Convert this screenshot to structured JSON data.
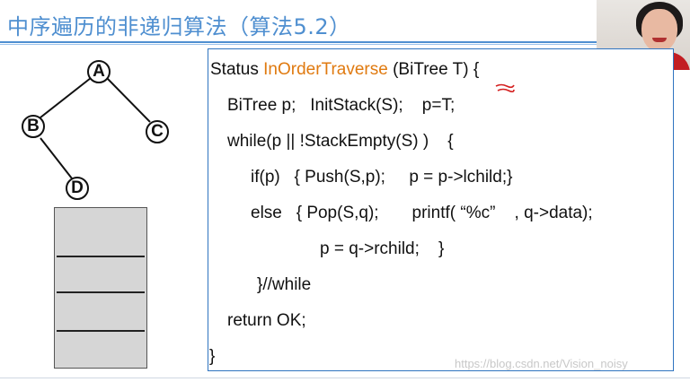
{
  "slide": {
    "title": "中序遍历的非递归算法（算法5.2）"
  },
  "tree": {
    "nodes": [
      "A",
      "B",
      "C",
      "D"
    ]
  },
  "code": {
    "line1_prefix": "Status ",
    "line1_fn": "InOrderTraverse",
    "line1_suffix": " (BiTree T) {",
    "line2": "BiTree p;   InitStack(S);    p=T;",
    "line3": "while(p || !StackEmpty(S) )    {",
    "line4": "if(p)   { Push(S,p);     p = p->lchild;}",
    "line5": "else   { Pop(S,q);       printf( “%c”    , q->data);",
    "line6": "p = q->rchild;    }",
    "line7": "}//while",
    "line8": "return OK;",
    "line9": "}"
  },
  "colors": {
    "title": "#4f8fd0",
    "function_name": "#e07a10",
    "code_border": "#2f74c0",
    "pen_annotation": "#d42020"
  },
  "watermark": {
    "text": "https://blog.csdn.net/Vision_noisy"
  }
}
